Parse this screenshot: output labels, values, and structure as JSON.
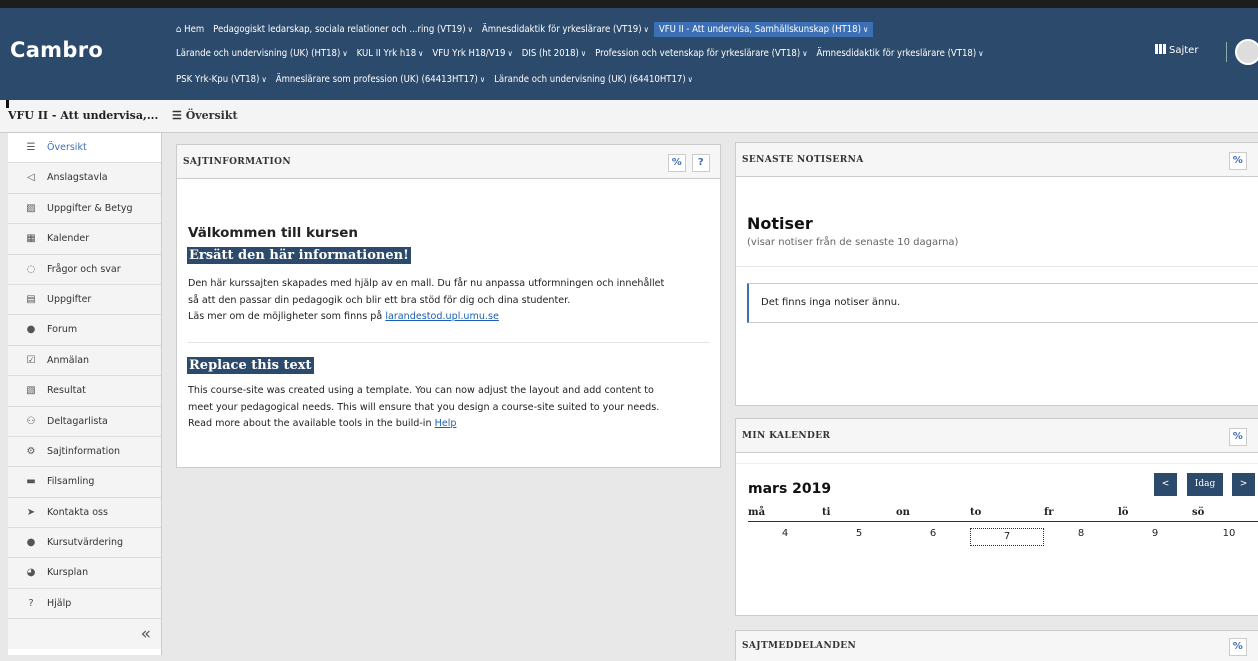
{
  "header": {
    "brand": "Cambro",
    "nav_row1": [
      "⌂ Hem",
      "Pedagogiskt ledarskap, sociala relationer och ...ring (VT19)",
      "Ämnesdidaktik för yrkeslärare (VT19)",
      "VFU II - Att undervisa, Samhällskunskap (HT18)"
    ],
    "nav_row1_caret": [
      false,
      true,
      true,
      true
    ],
    "nav_row2": [
      "Lärande och undervisning (UK) (HT18)",
      "KUL II Yrk h18",
      "VFU Yrk H18/V19",
      "DIS (ht 2018)",
      "Profession och vetenskap för yrkeslärare (VT18)",
      "Ämnesdidaktik för yrkeslärare (VT18)"
    ],
    "nav_row3": [
      "PSK Yrk-Kpu (VT18)",
      "Ämneslärare som profession (UK) (64413HT17)",
      "Lärande och undervisning (UK) (64410HT17)"
    ],
    "sites_label": "Sajter"
  },
  "subbar": {
    "site_title": "VFU II - Att undervisa,...",
    "page_title": "Översikt"
  },
  "sidebar": {
    "items": [
      {
        "label": "Översikt",
        "icon": "list-icon",
        "glyph": "☰"
      },
      {
        "label": "Anslagstavla",
        "icon": "megaphone-icon",
        "glyph": "◁"
      },
      {
        "label": "Uppgifter & Betyg",
        "icon": "book-icon",
        "glyph": "▨"
      },
      {
        "label": "Kalender",
        "icon": "calendar-icon",
        "glyph": "▦"
      },
      {
        "label": "Frågor och svar",
        "icon": "chat-icon",
        "glyph": "◌"
      },
      {
        "label": "Uppgifter",
        "icon": "file-icon",
        "glyph": "▤"
      },
      {
        "label": "Forum",
        "icon": "forum-icon",
        "glyph": "●"
      },
      {
        "label": "Anmälan",
        "icon": "calendar-check-icon",
        "glyph": "☑"
      },
      {
        "label": "Resultat",
        "icon": "notebook-icon",
        "glyph": "▧"
      },
      {
        "label": "Deltagarlista",
        "icon": "users-icon",
        "glyph": "⚇"
      },
      {
        "label": "Sajtinformation",
        "icon": "gear-icon",
        "glyph": "⚙"
      },
      {
        "label": "Filsamling",
        "icon": "folder-icon",
        "glyph": "▬"
      },
      {
        "label": "Kontakta oss",
        "icon": "send-icon",
        "glyph": "➤"
      },
      {
        "label": "Kursutvärdering",
        "icon": "comment-icon",
        "glyph": "●"
      },
      {
        "label": "Kursplan",
        "icon": "globe-icon",
        "glyph": "◕"
      },
      {
        "label": "Hjälp",
        "icon": "help-icon",
        "glyph": "?"
      }
    ],
    "collapse_glyph": "«"
  },
  "site_info": {
    "heading": "SAJTINFORMATION",
    "welcome": "Välkommen till kursen",
    "h_sv": "Ersätt den här informationen!",
    "p_sv_1": "Den här kurssajten skapades med hjälp av en mall. Du får nu anpassa utformningen och innehållet",
    "p_sv_2": "så att den passar din pedagogik och blir ett bra stöd för dig och dina studenter.",
    "p_sv_3": "Läs mer om de möjligheter som finns på",
    "link_sv": "larandestod.upl.umu.se",
    "h_en": "Replace this text",
    "p_en_1": "This course-site was created using a template. You can now adjust the layout and add content to",
    "p_en_2": "meet your pedagogical needs. This will ensure that you design a course-site suited to your needs.",
    "p_en_3": "Read more about the available tools in the build-in",
    "link_en": "Help"
  },
  "notices": {
    "heading": "SENASTE NOTISERNA",
    "title": "Notiser",
    "subtitle": "(visar notiser från de senaste 10 dagarna)",
    "empty": "Det finns inga notiser ännu."
  },
  "calendar": {
    "heading": "MIN KALENDER",
    "month": "mars 2019",
    "prev": "<",
    "today": "Idag",
    "next": ">",
    "days": [
      "må",
      "ti",
      "on",
      "to",
      "fr",
      "lö",
      "sö"
    ],
    "dates": [
      "4",
      "5",
      "6",
      "7",
      "8",
      "9",
      "10"
    ],
    "today_index": 3
  },
  "messages": {
    "heading": "SAJTMEDDELANDEN"
  },
  "colors": {
    "header_bg": "#2c4a6b",
    "active_nav": "#3d6fb5",
    "link": "#1a5fb4"
  }
}
